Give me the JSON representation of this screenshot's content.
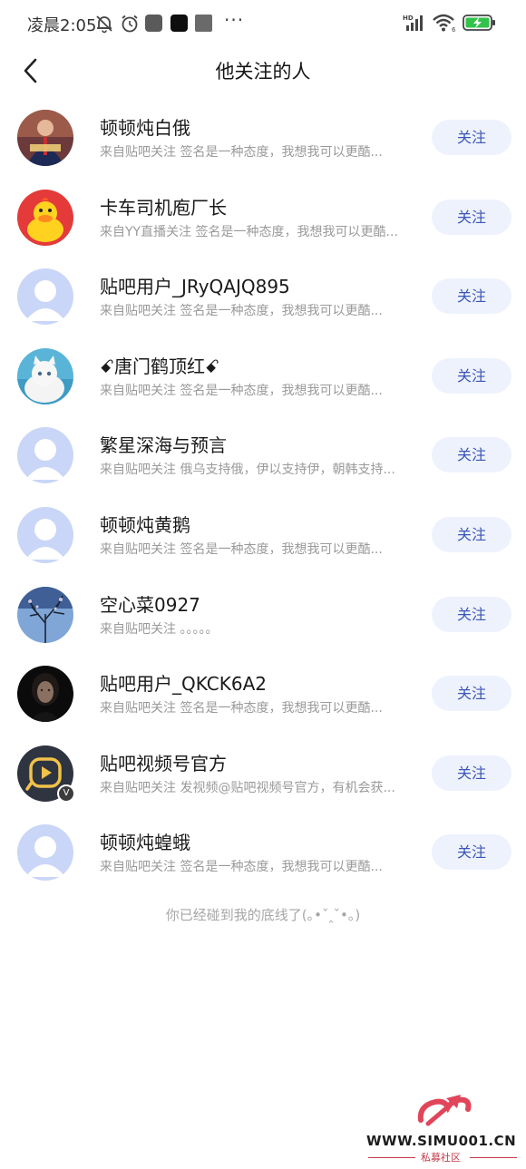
{
  "status_bar": {
    "time": "凌晨2:05",
    "icons": [
      "mute-bell-icon",
      "alarm-icon",
      "app-icon-gray",
      "app-icon-black",
      "app-icon-gray-2",
      "more-dots",
      "hd-signal-icon",
      "wifi-icon",
      "battery-charging-icon"
    ],
    "more": "···",
    "wifi_label": "6",
    "hd_label": "HD"
  },
  "header": {
    "title": "他关注的人",
    "back_icon": "chevron-left-icon"
  },
  "follow_list": [
    {
      "name": "顿顿炖白俄",
      "desc": "来自贴吧关注 签名是一种态度，我想我可以更酷...",
      "button": "关注",
      "avatar": "photo-person"
    },
    {
      "name": "卡车司机庖厂长",
      "desc": "来自YY直播关注 签名是一种态度，我想我可以更酷...",
      "button": "关注",
      "avatar": "yellow-duck"
    },
    {
      "name": "贴吧用户_JRyQAJQ895",
      "desc": "来自贴吧关注 签名是一种态度，我想我可以更酷...",
      "button": "关注",
      "avatar": "default"
    },
    {
      "name": "ꗃ唐门鹤顶红ꗃ",
      "desc": "来自贴吧关注 签名是一种态度，我想我可以更酷...",
      "button": "关注",
      "avatar": "white-cat"
    },
    {
      "name": "繁星深海与预言",
      "desc": "来自贴吧关注 俄乌支持俄，伊以支持伊，朝韩支持...",
      "button": "关注",
      "avatar": "default"
    },
    {
      "name": "顿顿炖黄鹅",
      "desc": "来自贴吧关注 签名是一种态度，我想我可以更酷...",
      "button": "关注",
      "avatar": "default"
    },
    {
      "name": "空心菜0927",
      "desc": "来自贴吧关注 。。。。。",
      "button": "关注",
      "avatar": "tree-sky"
    },
    {
      "name": "贴吧用户_QKCK6A2",
      "desc": "来自贴吧关注 签名是一种态度，我想我可以更酷...",
      "button": "关注",
      "avatar": "dark-portrait"
    },
    {
      "name": "贴吧视频号官方",
      "desc": "来自贴吧关注 发视频@贴吧视频号官方，有机会获...",
      "button": "关注",
      "avatar": "video-logo",
      "badge": "V"
    },
    {
      "name": "顿顿炖蝗蛾",
      "desc": "来自贴吧关注 签名是一种态度，我想我可以更酷...",
      "button": "关注",
      "avatar": "default"
    }
  ],
  "bottom_hint": "你已经碰到我的底线了(｡•ˇ‸ˇ•｡)",
  "watermark": {
    "url": "WWW.SIMU001.CN",
    "subtitle": "私募社区"
  },
  "colors": {
    "follow_button_bg": "#eef2fd",
    "follow_button_text": "#3a55b8",
    "desc_text": "#9a9a9a",
    "default_avatar": "#c9d6f8"
  }
}
